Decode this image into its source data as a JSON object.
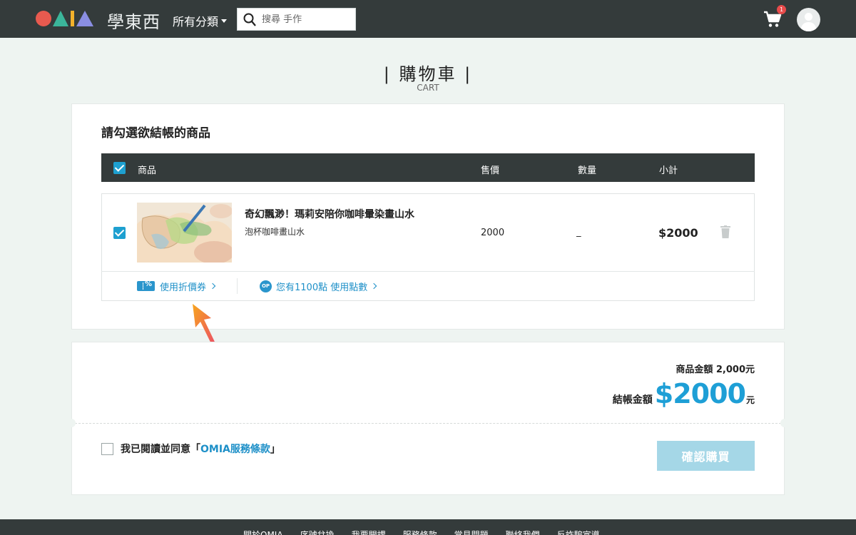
{
  "header": {
    "brand_cn": "學東西",
    "category_label": "所有分類",
    "search": {
      "placeholder": "搜尋 手作",
      "value": ""
    },
    "cart_count": "1"
  },
  "page": {
    "title": "| 購物車 |",
    "subtitle": "CART"
  },
  "cart": {
    "section_title": "請勾選欲結帳的商品",
    "columns": {
      "product": "商品",
      "price": "售價",
      "quantity": "數量",
      "subtotal": "小計"
    },
    "items": [
      {
        "name": "奇幻飄渺！瑪莉安陪你咖啡暈染畫山水",
        "option": "泡杯咖啡畫山水",
        "price": "2000",
        "quantity": "_",
        "subtotal": "$2000",
        "checked": true
      }
    ],
    "coupon_label": "使用折價券",
    "points_badge": "OP",
    "points_label": "您有1100點 使用點數"
  },
  "summary": {
    "product_total": "商品金額 2,000元",
    "checkout_label": "結帳金額",
    "checkout_amount": "$2000",
    "checkout_unit": "元",
    "agree_prefix": "我已閱讀並同意「",
    "agree_link": "OMIA服務條款",
    "agree_suffix": "」",
    "confirm_label": "確認購買"
  },
  "footer": {
    "links": [
      "關於OMIA",
      "序號兌換",
      "我要開課",
      "服務條款",
      "常見問題",
      "聯絡我們",
      "反詐騙宣導"
    ]
  },
  "colors": {
    "accent": "#1e9fd6",
    "header_bg": "#343b3b",
    "page_bg": "#eef4f1",
    "button_disabled": "#a5d7e7"
  }
}
